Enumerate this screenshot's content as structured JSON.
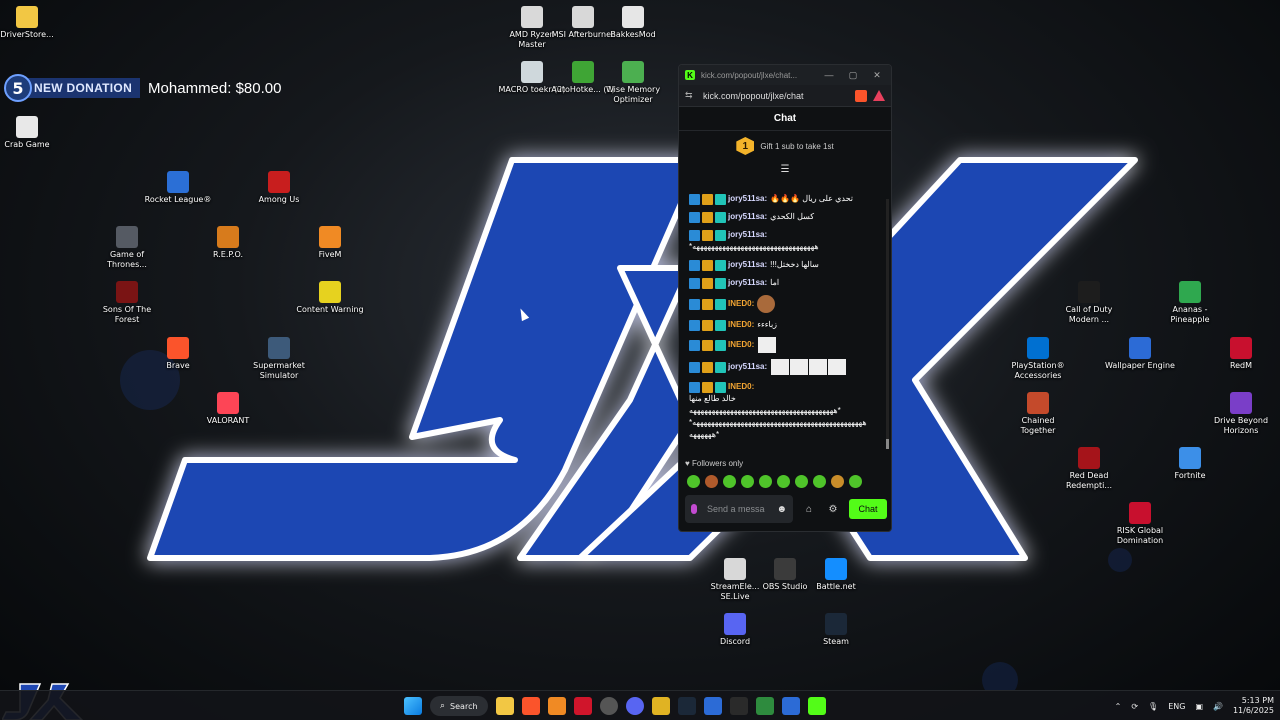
{
  "donation": {
    "badge": "5",
    "label": "NEW DONATION",
    "text": "Mohammed: $80.00"
  },
  "desktop_icons": [
    {
      "label": "DriverStore...",
      "icon": "folder-icon",
      "color": "#f2c744"
    },
    {
      "label": "Crab Game",
      "icon": "crab-game-icon",
      "color": "#e8e8e8"
    },
    {
      "label": "AMD Ryzen Master",
      "icon": "amd-ryzen-master-icon",
      "color": "#d9d9d9"
    },
    {
      "label": "MSI Afterburner",
      "icon": "msi-afterburner-icon",
      "color": "#d8d8d8"
    },
    {
      "label": "BakkesMod",
      "icon": "bakkesmod-icon",
      "color": "#e6e6e6"
    },
    {
      "label": "MACRO toekr (2)",
      "icon": "macro-icon",
      "color": "#cfd8dc"
    },
    {
      "label": "AutoHotke... (1)",
      "icon": "autohotkey-icon",
      "color": "#3fa535"
    },
    {
      "label": "Wise Memory Optimizer",
      "icon": "wise-memory-icon",
      "color": "#4caf50"
    },
    {
      "label": "Rocket League®",
      "icon": "rocket-league-icon",
      "color": "#2b6fd6"
    },
    {
      "label": "Among Us",
      "icon": "among-us-icon",
      "color": "#c81e1e"
    },
    {
      "label": "Game of Thrones...",
      "icon": "game-of-thrones-icon",
      "color": "#555a63"
    },
    {
      "label": "R.E.P.O.",
      "icon": "repo-icon",
      "color": "#d77b1c"
    },
    {
      "label": "FiveM",
      "icon": "fivem-icon",
      "color": "#f08a24"
    },
    {
      "label": "Sons Of The Forest",
      "icon": "sons-of-the-forest-icon",
      "color": "#7a1414"
    },
    {
      "label": "Content Warning",
      "icon": "content-warning-icon",
      "color": "#e6d21f"
    },
    {
      "label": "Brave",
      "icon": "brave-icon",
      "color": "#fb542b"
    },
    {
      "label": "Supermarket Simulator",
      "icon": "supermarket-simulator-icon",
      "color": "#3d5a7a"
    },
    {
      "label": "VALORANT",
      "icon": "valorant-icon",
      "color": "#fd4556"
    },
    {
      "label": "Call of Duty Modern ...",
      "icon": "call-of-duty-icon",
      "color": "#1d1d1d"
    },
    {
      "label": "Ananas - Pineapple",
      "icon": "ananas-icon",
      "color": "#2fa84f"
    },
    {
      "label": "PlayStation® Accessories",
      "icon": "playstation-icon",
      "color": "#0070d1"
    },
    {
      "label": "Wallpaper Engine",
      "icon": "wallpaper-engine-icon",
      "color": "#2c6bd6"
    },
    {
      "label": "RedM",
      "icon": "redm-icon",
      "color": "#c8102e"
    },
    {
      "label": "Chained Together",
      "icon": "chained-together-icon",
      "color": "#c44a2b"
    },
    {
      "label": "Drive Beyond Horizons",
      "icon": "drive-beyond-icon",
      "color": "#7a3ec8"
    },
    {
      "label": "Red Dead Redempti...",
      "icon": "red-dead-icon",
      "color": "#a5141a"
    },
    {
      "label": "Fortnite",
      "icon": "fortnite-icon",
      "color": "#3c8fe8"
    },
    {
      "label": "RISK Global Domination",
      "icon": "risk-icon",
      "color": "#c8102e"
    },
    {
      "label": "StreamEle... SE.Live",
      "icon": "streamelements-icon",
      "color": "#d8d8d8"
    },
    {
      "label": "OBS Studio",
      "icon": "obs-icon",
      "color": "#3b3b3b"
    },
    {
      "label": "Battle.net",
      "icon": "battlenet-icon",
      "color": "#148eff"
    },
    {
      "label": "Discord",
      "icon": "discord-icon",
      "color": "#5865f2"
    },
    {
      "label": "Steam",
      "icon": "steam-icon",
      "color": "#1b2838"
    }
  ],
  "chat_window": {
    "title": "kick.com/popout/jlxe/chat...",
    "url": "kick.com/popout/jlxe/chat",
    "header": "Chat",
    "gift_badge": "1",
    "gift_text": "Gift 1 sub to take 1st",
    "messages": [
      {
        "user": "jory511sa:",
        "user_class": "u-jory",
        "text": "🔥🔥🔥 تحدي على ريال"
      },
      {
        "user": "jory511sa:",
        "user_class": "u-jory",
        "text": "كسل الكحدي"
      },
      {
        "user": "jory511sa:",
        "user_class": "u-jory",
        "text": "*هههههههههههههههههههههههههههههههههه"
      },
      {
        "user": "jory511sa:",
        "user_class": "u-jory",
        "text": "!!!سالها دخختل"
      },
      {
        "user": "jory511sa:",
        "user_class": "u-jory",
        "text": "اما"
      },
      {
        "user": "INED0:",
        "user_class": "u-ined",
        "text": ""
      },
      {
        "user": "INED0:",
        "user_class": "u-ined",
        "text": "زباءءء"
      },
      {
        "user": "INED0:",
        "user_class": "u-ined",
        "text": ""
      },
      {
        "user": "jory511sa:",
        "user_class": "u-jory",
        "text": ""
      },
      {
        "user": "INED0:",
        "user_class": "u-ined",
        "text": "خالد طالع منها *هههههههههههههههههههههههههههههههههههههههه ههههههههههههههههههههههههههههههههههههههههههههههه* *ههههههه"
      }
    ],
    "followers_only": "Followers only",
    "input_placeholder": "Send a message",
    "chat_button": "Chat"
  },
  "taskbar": {
    "search_label": "Search",
    "language": "ENG",
    "time": "5:13 PM",
    "date": "11/6/2025"
  },
  "colors": {
    "kick_green": "#53fc18",
    "wallpaper_blue": "#1f47b3"
  }
}
